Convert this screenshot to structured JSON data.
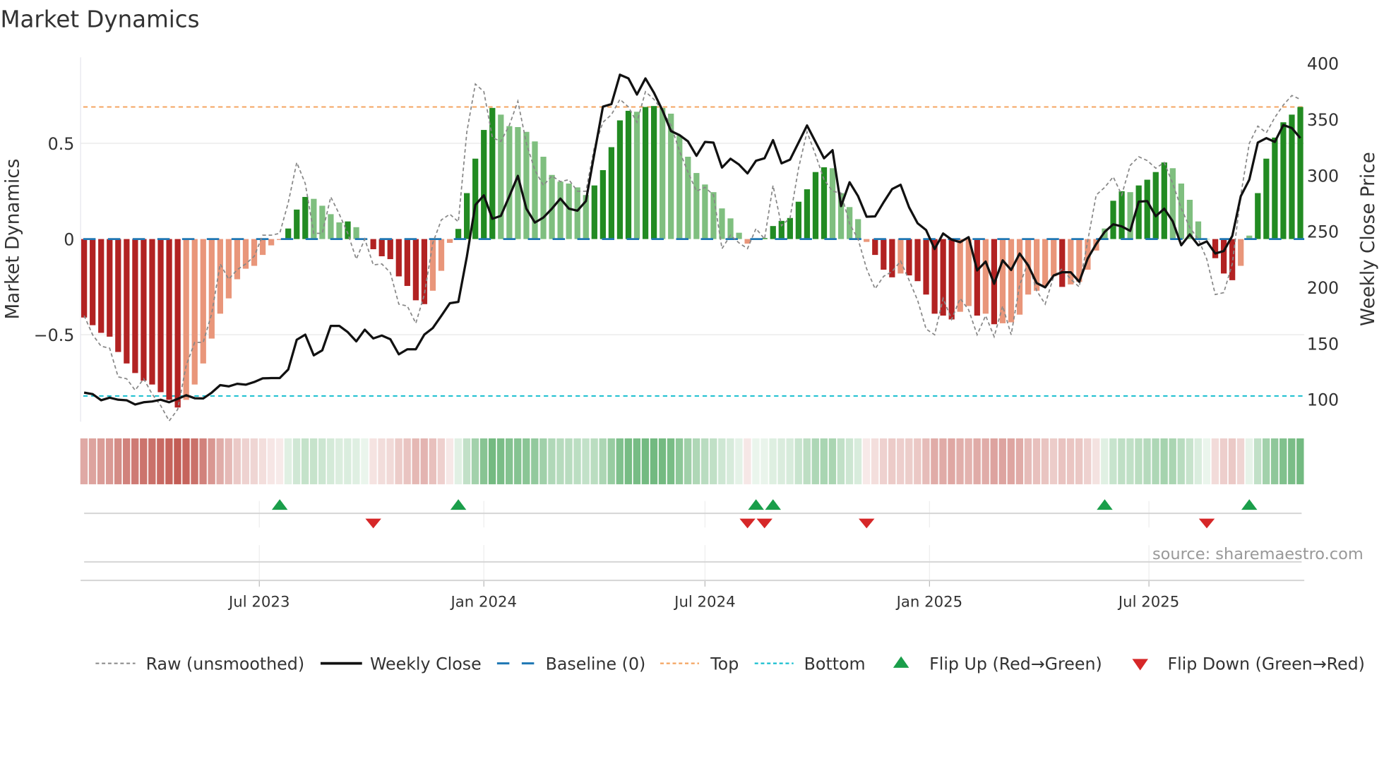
{
  "chart_data": {
    "type": "bar",
    "title": "Market Dynamics",
    "ylabel": "Market Dynamics",
    "y2label": "Weekly Close Price",
    "ylim": [
      -0.96,
      0.96
    ],
    "y2lim": [
      80,
      400
    ],
    "yticks": [
      {
        "value": 0.5,
        "label": "0.5"
      },
      {
        "value": 0,
        "label": "0"
      },
      {
        "value": -0.5,
        "label": "−0.5"
      }
    ],
    "y2ticks": [
      {
        "value": 400,
        "label": "400"
      },
      {
        "value": 350,
        "label": "350"
      },
      {
        "value": 300,
        "label": "300"
      },
      {
        "value": 250,
        "label": "250"
      },
      {
        "value": 200,
        "label": "200"
      },
      {
        "value": 150,
        "label": "150"
      },
      {
        "value": 100,
        "label": "100"
      }
    ],
    "xticks": [
      {
        "week": 20.6,
        "label": "Jul 2023"
      },
      {
        "week": 47.0,
        "label": "Jan 2024"
      },
      {
        "week": 73.0,
        "label": "Jul 2024"
      },
      {
        "week": 99.4,
        "label": "Jan 2025"
      },
      {
        "week": 125.2,
        "label": "Jul 2025"
      }
    ],
    "top_level": 0.69,
    "bottom_level": -0.82,
    "baseline": 0,
    "momentum": [
      -0.41,
      -0.45,
      -0.49,
      -0.51,
      -0.59,
      -0.65,
      -0.7,
      -0.74,
      -0.76,
      -0.8,
      -0.84,
      -0.88,
      -0.84,
      -0.76,
      -0.65,
      -0.52,
      -0.39,
      -0.31,
      -0.21,
      -0.155,
      -0.14,
      -0.083,
      -0.033,
      -0.005,
      0.055,
      0.154,
      0.22,
      0.21,
      0.174,
      0.13,
      0.087,
      0.092,
      0.062,
      0.0,
      -0.053,
      -0.09,
      -0.105,
      -0.195,
      -0.245,
      -0.32,
      -0.34,
      -0.27,
      -0.166,
      -0.02,
      0.053,
      0.24,
      0.42,
      0.57,
      0.685,
      0.65,
      0.59,
      0.585,
      0.56,
      0.51,
      0.43,
      0.335,
      0.3,
      0.29,
      0.27,
      0.23,
      0.28,
      0.36,
      0.48,
      0.62,
      0.67,
      0.665,
      0.69,
      0.695,
      0.685,
      0.655,
      0.54,
      0.43,
      0.345,
      0.285,
      0.245,
      0.16,
      0.108,
      0.033,
      -0.024,
      0.0,
      0.005,
      0.068,
      0.095,
      0.11,
      0.195,
      0.26,
      0.35,
      0.375,
      0.37,
      0.24,
      0.167,
      0.104,
      -0.015,
      -0.083,
      -0.16,
      -0.2,
      -0.18,
      -0.19,
      -0.22,
      -0.29,
      -0.39,
      -0.4,
      -0.42,
      -0.38,
      -0.35,
      -0.4,
      -0.39,
      -0.445,
      -0.44,
      -0.435,
      -0.395,
      -0.29,
      -0.27,
      -0.245,
      -0.195,
      -0.25,
      -0.237,
      -0.224,
      -0.16,
      -0.06,
      0.055,
      0.2,
      0.25,
      0.245,
      0.28,
      0.31,
      0.35,
      0.4,
      0.37,
      0.29,
      0.205,
      0.092,
      0.0,
      -0.1,
      -0.18,
      -0.215,
      -0.14,
      0.018,
      0.24,
      0.42,
      0.53,
      0.61,
      0.65,
      0.69
    ],
    "raw": [
      -0.4,
      -0.5,
      -0.56,
      -0.57,
      -0.72,
      -0.73,
      -0.79,
      -0.73,
      -0.81,
      -0.87,
      -0.95,
      -0.89,
      -0.66,
      -0.54,
      -0.54,
      -0.39,
      -0.13,
      -0.21,
      -0.16,
      -0.13,
      -0.09,
      0.02,
      0.02,
      0.03,
      0.19,
      0.4,
      0.29,
      0.03,
      0.03,
      0.22,
      0.13,
      0.03,
      -0.105,
      0.0,
      -0.135,
      -0.13,
      -0.175,
      -0.34,
      -0.35,
      -0.44,
      -0.29,
      -0.02,
      0.1,
      0.13,
      0.09,
      0.56,
      0.81,
      0.77,
      0.53,
      0.51,
      0.595,
      0.72,
      0.5,
      0.36,
      0.28,
      0.33,
      0.3,
      0.31,
      0.25,
      0.25,
      0.48,
      0.61,
      0.65,
      0.73,
      0.69,
      0.61,
      0.77,
      0.73,
      0.67,
      0.595,
      0.46,
      0.35,
      0.25,
      0.27,
      0.23,
      -0.05,
      0.02,
      -0.02,
      -0.05,
      0.055,
      0.0,
      0.28,
      0.07,
      0.11,
      0.37,
      0.56,
      0.44,
      0.31,
      0.25,
      0.24,
      0.08,
      0.0,
      -0.155,
      -0.26,
      -0.195,
      -0.17,
      -0.115,
      -0.215,
      -0.32,
      -0.47,
      -0.5,
      -0.31,
      -0.42,
      -0.31,
      -0.37,
      -0.5,
      -0.4,
      -0.51,
      -0.35,
      -0.5,
      -0.24,
      -0.12,
      -0.27,
      -0.34,
      -0.195,
      -0.155,
      -0.21,
      -0.25,
      -0.01,
      0.23,
      0.27,
      0.325,
      0.23,
      0.385,
      0.43,
      0.41,
      0.37,
      0.4,
      0.29,
      0.16,
      0.06,
      0.0,
      -0.105,
      -0.29,
      -0.28,
      -0.13,
      0.23,
      0.5,
      0.59,
      0.555,
      0.635,
      0.7,
      0.75,
      0.73
    ],
    "weekly_close": [
      106.2,
      104.9,
      99.4,
      101.7,
      99.9,
      99.4,
      95.6,
      97.6,
      98.3,
      99.9,
      97.6,
      100.6,
      103.9,
      101.2,
      101,
      106.2,
      112.9,
      111.8,
      114.1,
      113.3,
      115.7,
      119,
      119.2,
      119.2,
      126.9,
      153.4,
      158,
      139.5,
      144,
      165.8,
      165.8,
      160.2,
      152,
      162.4,
      154.6,
      157.2,
      153.9,
      140.4,
      144.9,
      144.9,
      158,
      163.9,
      174.8,
      186,
      187.2,
      227.6,
      273.8,
      282.3,
      261.4,
      264,
      281.6,
      299.7,
      270.4,
      258,
      262.5,
      270.4,
      279.4,
      270.4,
      268.6,
      277.2,
      319.9,
      361.5,
      363.8,
      390,
      386.7,
      372.3,
      386.7,
      373.9,
      358.2,
      339.7,
      336.1,
      330.5,
      317.6,
      330,
      329.4,
      307.1,
      315,
      309.8,
      301.9,
      313.2,
      315.4,
      331.6,
      310.9,
      314.2,
      329.4,
      344.7,
      330,
      315.4,
      322.6,
      272.7,
      294,
      281.6,
      263.2,
      263.5,
      276.1,
      287.9,
      291.8,
      271.6,
      257.4,
      251.3,
      234.4,
      248.3,
      242.8,
      240.5,
      245,
      215.3,
      223.2,
      203.4,
      224.3,
      215.7,
      230.4,
      219.8,
      204,
      200.2,
      210.8,
      213.7,
      213.7,
      205.2,
      225.9,
      238.9,
      249.7,
      256.5,
      254.6,
      250.6,
      276.7,
      277.2,
      263.7,
      270.4,
      259.1,
      237.8,
      247.5,
      237.8,
      241.2,
      230.4,
      232.6,
      246.1,
      281.6,
      296.3,
      329.4,
      333.4,
      330,
      345.1,
      342.4,
      333.4
    ],
    "flip_up_weeks": [
      23,
      44,
      79,
      81,
      120,
      137
    ],
    "flip_down_weeks": [
      34,
      78,
      80,
      92,
      132
    ],
    "legend": {
      "position": "bottom",
      "items": [
        {
          "key": "raw",
          "label": "Raw (unsmoothed)"
        },
        {
          "key": "close",
          "label": "Weekly Close"
        },
        {
          "key": "baseline",
          "label": "Baseline (0)"
        },
        {
          "key": "top",
          "label": "Top"
        },
        {
          "key": "bottom",
          "label": "Bottom"
        },
        {
          "key": "flipup",
          "label": "Flip Up (Red→Green)"
        },
        {
          "key": "flipdown",
          "label": "Flip Down (Green→Red)"
        }
      ]
    },
    "source": "source: sharemaestro.com",
    "colors": {
      "red_strong": "#b22222",
      "red_weak": "#e9967a",
      "green_strong": "#228b22",
      "green_weak": "#7fbf7f",
      "close": "#111111",
      "raw": "#888888",
      "baseline": "#1f77b4",
      "top": "#f4a460",
      "bottom": "#17becf",
      "flip_up": "#1a9e4a",
      "flip_down": "#d62728",
      "heat_red": "#c25a52",
      "heat_green": "#4fa860"
    }
  }
}
